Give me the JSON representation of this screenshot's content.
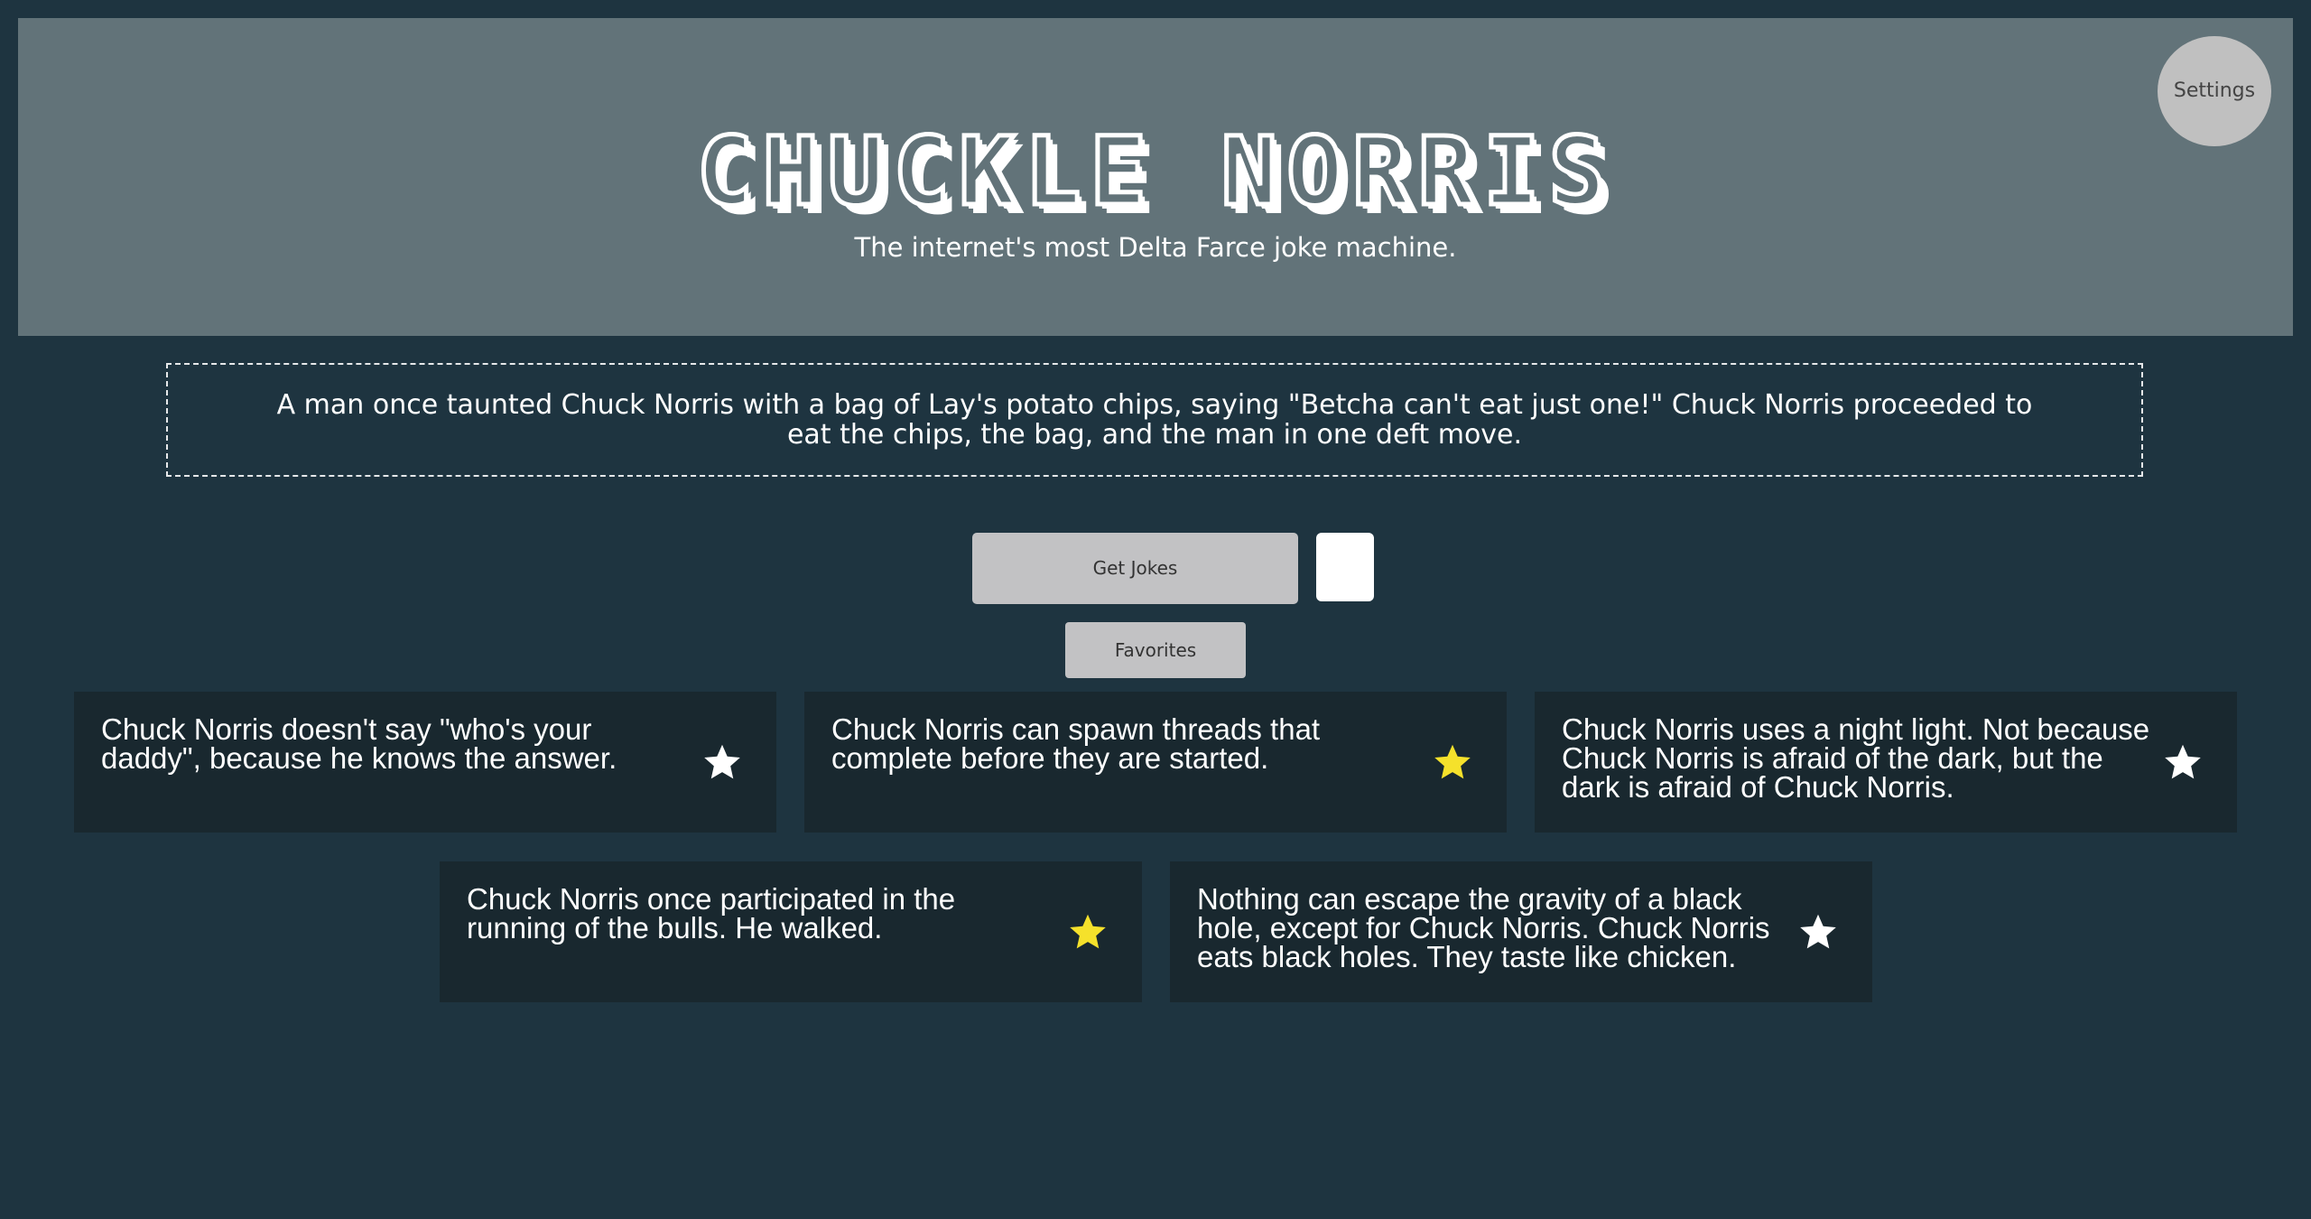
{
  "header": {
    "title": "CHUCKLE NORRIS",
    "subtitle": "The internet's most Delta Farce joke machine.",
    "settings_label": "Settings"
  },
  "featured_joke": "A man once taunted Chuck Norris with a bag of Lay's potato chips, saying \"Betcha can't eat just one!\" Chuck Norris proceeded to eat the chips, the bag, and the man in one deft move.",
  "controls": {
    "get_jokes_label": "Get Jokes",
    "count_value": "",
    "favorites_label": "Favorites"
  },
  "colors": {
    "background": "#1e3440",
    "header": "#627379",
    "card": "#19282f",
    "star_favorited": "#f5e12b",
    "star_default": "#ffffff"
  },
  "jokes": [
    {
      "text": "Chuck Norris doesn't say \"who's your daddy\", because he knows the answer.",
      "favorited": false
    },
    {
      "text": "Chuck Norris can spawn threads that complete before they are started.",
      "favorited": true
    },
    {
      "text": "Chuck Norris uses a night light. Not because Chuck Norris is afraid of the dark, but the dark is afraid of Chuck Norris.",
      "favorited": false
    },
    {
      "text": "Chuck Norris once participated in the running of the bulls. He walked.",
      "favorited": true
    },
    {
      "text": "Nothing can escape the gravity of a black hole, except for Chuck Norris. Chuck Norris eats black holes. They taste like chicken.",
      "favorited": false
    }
  ]
}
